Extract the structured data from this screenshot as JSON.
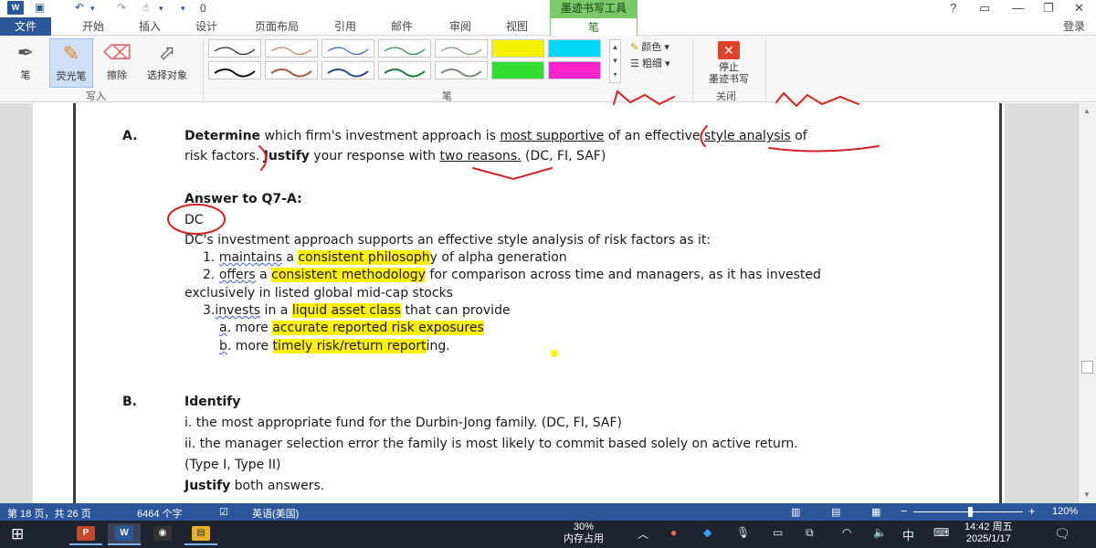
{
  "quick_access": {
    "counter": "0"
  },
  "title_bar": {
    "contextual_tab_group": "墨迹书写工具",
    "help": "?",
    "minimize": "—",
    "restore": "❐",
    "close": "✕"
  },
  "tabs": [
    "文件",
    "开始",
    "插入",
    "设计",
    "页面布局",
    "引用",
    "邮件",
    "审阅",
    "视图",
    "笔"
  ],
  "account": {
    "login": "登录"
  },
  "ribbon": {
    "write_group": {
      "label": "写入",
      "pen": "笔",
      "highlighter": "荧光笔",
      "eraser": "擦除",
      "select": "选择对象"
    },
    "pens_group": {
      "label": "笔",
      "color": "颜色",
      "thickness": "粗细"
    },
    "close_group": {
      "label": "关闭",
      "stop_line1": "停止",
      "stop_line2": "墨迹书写"
    },
    "pen_colors": [
      "#2e2e2e",
      "#c0826a",
      "#3a6aa8",
      "#2e8b57",
      "#7aa37a",
      "#f4f400",
      "#00d6f5",
      "#111111",
      "#a05a3a",
      "#2a4a8a",
      "#1e7a3a",
      "#7a8a7a",
      "#33dd33",
      "#ff22cc"
    ]
  },
  "document": {
    "a_marker": "A.",
    "a_q1_bold": "Determine",
    "a_q1_p1": " which firm's investment approach is ",
    "a_q1_u1": "most supportive",
    "a_q1_p2": " of an ",
    "a_q1_p3": "effective ",
    "a_q1_u2": "style analysis",
    "a_q1_p4": " of",
    "a_q2_p1": "risk factors. ",
    "a_q2_bold": "Justify",
    "a_q2_p2": " your response with ",
    "a_q2_u1": "two reasons.",
    "a_q2_p3": " (DC, FI, SAF)",
    "answer_heading": "Answer to Q7-A:",
    "answer_value": "DC",
    "answer_intro": "DC's investment approach supports an effective style analysis of risk factors as it:",
    "item1_num": "1. ",
    "item1_w1": "maintains",
    "item1_p1": " a ",
    "item1_hl": "consistent philosoph",
    "item1_p2": "y of alpha generation",
    "item2_num": "2. ",
    "item2_w1": "offers",
    "item2_p1": " a ",
    "item2_hl": "consistent methodology",
    "item2_p2": " for comparison across time and managers, as it has invested",
    "item2_cont": "exclusively in listed global mid-cap stocks",
    "item3_num": "3.",
    "item3_w1": "invests",
    "item3_p1": " in a ",
    "item3_hl": "liquid asset class",
    "item3_p2": " that can provide",
    "sub_a_letter": "a",
    "sub_a_p1": ". more ",
    "sub_a_hl": "accurate reported risk exposures",
    "sub_b_letter": "b",
    "sub_b_p1": ". more ",
    "sub_b_hl": "timely risk/return report",
    "sub_b_p2": "ing.",
    "b_marker": "B.",
    "b_heading": "Identify",
    "b_line1": "i. the most appropriate fund for the Durbin-Jong family. (DC, FI, SAF)",
    "b_line2": "ii. the manager selection error the family is most likely to commit based solely on active return.",
    "b_line3": "(Type I, Type II)",
    "b_justify_bold": "Justify",
    "b_justify_rest": " both answers."
  },
  "status_bar": {
    "page": "第 18 页，共 26 页",
    "words": "6464 个字",
    "language": "英语(美国)",
    "zoom": "120%",
    "zoom_minus": "−",
    "zoom_plus": "+"
  },
  "taskbar": {
    "apps": [
      "P",
      "W",
      "◉",
      "▤"
    ],
    "memory_value": "30%",
    "memory_label": "内存占用",
    "ime_lang": "中",
    "ime_mode": "拼",
    "time": "14:42 周五",
    "date": "2025/1/17"
  },
  "colors": {
    "ribbon_blue": "#2b579a",
    "ink_red": "#d22323",
    "highlight": "#fff200",
    "context_green": "#7ac96b"
  }
}
